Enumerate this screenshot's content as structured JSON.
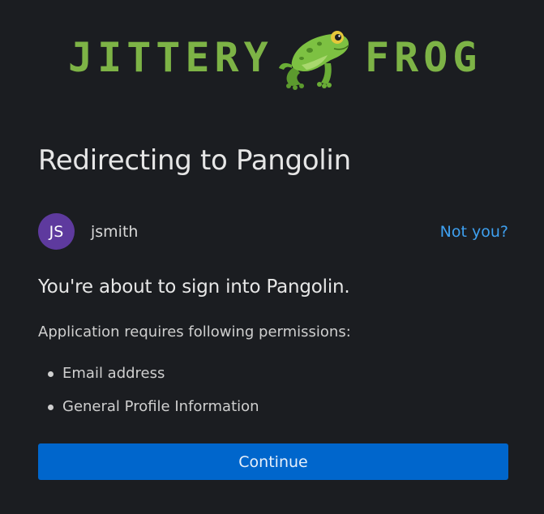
{
  "logo": {
    "text_left": "JITTERY",
    "text_right": "FROG",
    "icon": "frog-logo",
    "color": "#7db346"
  },
  "page": {
    "title": "Redirecting to Pangolin"
  },
  "user": {
    "initials": "JS",
    "username": "jsmith",
    "avatar_color": "#5e3a9e",
    "not_you_label": "Not you?"
  },
  "consent": {
    "heading": "You're about to sign into Pangolin.",
    "permissions_intro": "Application requires following permissions:",
    "permissions": [
      "Email address",
      "General Profile Information"
    ]
  },
  "actions": {
    "continue_label": "Continue",
    "primary_color": "#0066cc",
    "link_color": "#3ea0f0"
  }
}
